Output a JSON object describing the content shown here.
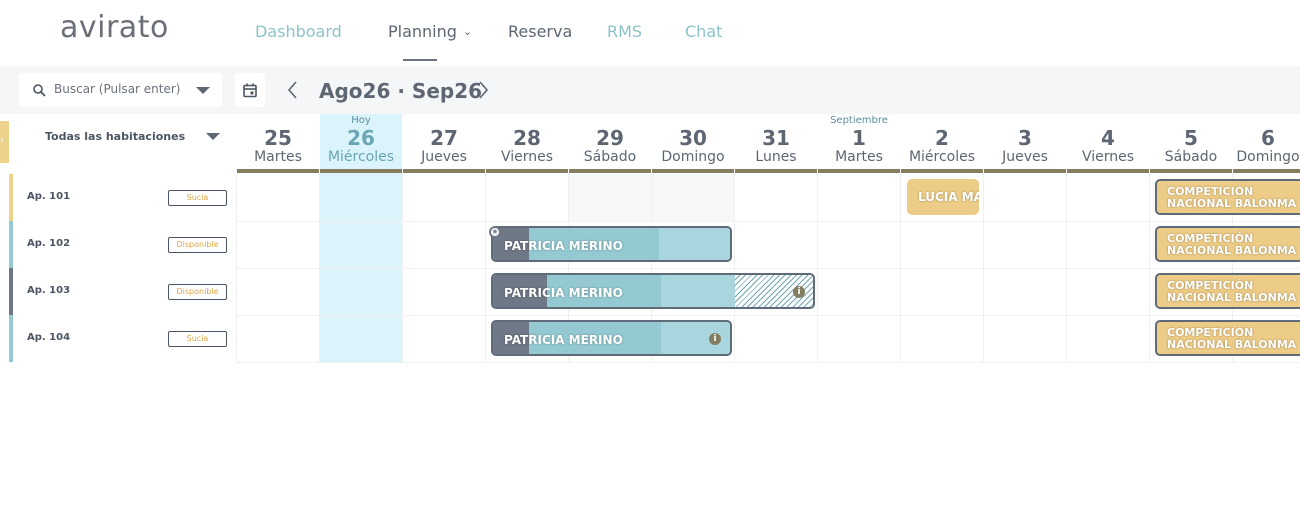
{
  "app": {
    "logo": "avirato"
  },
  "nav": {
    "items": [
      {
        "label": "Dashboard"
      },
      {
        "label": "Planning"
      },
      {
        "label": "Reserva"
      },
      {
        "label": "RMS"
      },
      {
        "label": "Chat"
      }
    ]
  },
  "toolbar": {
    "search_placeholder": "Buscar (Pulsar enter)",
    "period_start": "Ago26",
    "period_sep": "·",
    "period_end": "Sep26"
  },
  "rooms_filter": {
    "label": "Todas las habitaciones"
  },
  "days": [
    {
      "num": "25",
      "weekday": "Martes",
      "note": ""
    },
    {
      "num": "26",
      "weekday": "Miércoles",
      "note": "Hoy"
    },
    {
      "num": "27",
      "weekday": "Jueves",
      "note": ""
    },
    {
      "num": "28",
      "weekday": "Viernes",
      "note": ""
    },
    {
      "num": "29",
      "weekday": "Sábado",
      "note": ""
    },
    {
      "num": "30",
      "weekday": "Domingo",
      "note": ""
    },
    {
      "num": "31",
      "weekday": "Lunes",
      "note": ""
    },
    {
      "num": "1",
      "weekday": "Martes",
      "note": "Septiembre"
    },
    {
      "num": "2",
      "weekday": "Miércoles",
      "note": ""
    },
    {
      "num": "3",
      "weekday": "Jueves",
      "note": ""
    },
    {
      "num": "4",
      "weekday": "Viernes",
      "note": ""
    },
    {
      "num": "5",
      "weekday": "Sábado",
      "note": ""
    },
    {
      "num": "6",
      "weekday": "Domingo",
      "note": ""
    }
  ],
  "rooms": [
    {
      "name": "Ap. 101",
      "status": "Sucia"
    },
    {
      "name": "Ap. 102",
      "status": "Disponible"
    },
    {
      "name": "Ap. 103",
      "status": "Disponible"
    },
    {
      "name": "Ap. 104",
      "status": "Sucia"
    }
  ],
  "bookings": {
    "lucia": {
      "guest": "LUCIA MA"
    },
    "patricia_102": {
      "guest": "PATRICIA MERINO"
    },
    "patricia_103": {
      "guest": "PATRICIA MERINO"
    },
    "patricia_104": {
      "guest": "PATRICIA MERINO"
    },
    "competicion": {
      "line1": "COMPETICIÓN",
      "line2": "NACIONAL BALONMA"
    }
  },
  "colors": {
    "accent_teal": "#8cc3c8",
    "today_bg": "#dbf3fb",
    "booking_teal": "#94c9d2",
    "booking_gold": "#edcc87",
    "status_text": "#e0a442"
  },
  "icons": {
    "search": "search-icon",
    "calendar": "calendar-icon",
    "prev": "chevron-left-icon",
    "next": "chevron-right-icon",
    "info": "info-icon",
    "star": "star-icon"
  }
}
